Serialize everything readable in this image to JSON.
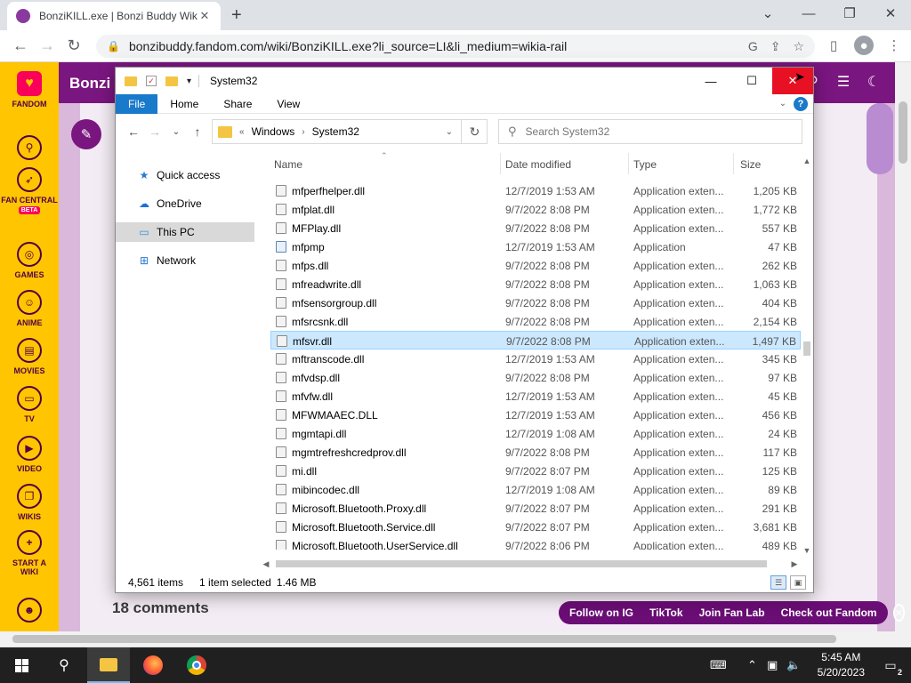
{
  "browser": {
    "tab_title": "BonziKILL.exe | Bonzi Buddy Wiki",
    "url": "bonzibuddy.fandom.com/wiki/BonziKILL.exe?li_source=LI&li_medium=wikia-rail"
  },
  "fandom_rail": {
    "logo_label": "FANDOM",
    "items": [
      {
        "label": "FAN CENTRAL",
        "badge": "BETA"
      },
      {
        "label": "GAMES"
      },
      {
        "label": "ANIME"
      },
      {
        "label": "MOVIES"
      },
      {
        "label": "TV"
      },
      {
        "label": "VIDEO"
      },
      {
        "label": "WIKIS"
      },
      {
        "label": "START A WIKI"
      }
    ]
  },
  "wiki": {
    "name": "Bonzi",
    "comments_heading": "18 comments",
    "follow_bar": [
      "Follow on IG",
      "TikTok",
      "Join Fan Lab",
      "Check out Fandom"
    ]
  },
  "explorer": {
    "window_title": "System32",
    "ribbon_tabs": [
      "File",
      "Home",
      "Share",
      "View"
    ],
    "breadcrumb": [
      "Windows",
      "System32"
    ],
    "search_placeholder": "Search System32",
    "nav_items": [
      "Quick access",
      "OneDrive",
      "This PC",
      "Network"
    ],
    "columns": {
      "name": "Name",
      "date": "Date modified",
      "type": "Type",
      "size": "Size"
    },
    "files": [
      {
        "name": "mfperfhelper.dll",
        "date": "12/7/2019 1:53 AM",
        "type": "Application exten...",
        "size": "1,205 KB"
      },
      {
        "name": "mfplat.dll",
        "date": "9/7/2022 8:08 PM",
        "type": "Application exten...",
        "size": "1,772 KB"
      },
      {
        "name": "MFPlay.dll",
        "date": "9/7/2022 8:08 PM",
        "type": "Application exten...",
        "size": "557 KB"
      },
      {
        "name": "mfpmp",
        "date": "12/7/2019 1:53 AM",
        "type": "Application",
        "size": "47 KB"
      },
      {
        "name": "mfps.dll",
        "date": "9/7/2022 8:08 PM",
        "type": "Application exten...",
        "size": "262 KB"
      },
      {
        "name": "mfreadwrite.dll",
        "date": "9/7/2022 8:08 PM",
        "type": "Application exten...",
        "size": "1,063 KB"
      },
      {
        "name": "mfsensorgroup.dll",
        "date": "9/7/2022 8:08 PM",
        "type": "Application exten...",
        "size": "404 KB"
      },
      {
        "name": "mfsrcsnk.dll",
        "date": "9/7/2022 8:08 PM",
        "type": "Application exten...",
        "size": "2,154 KB"
      },
      {
        "name": "mfsvr.dll",
        "date": "9/7/2022 8:08 PM",
        "type": "Application exten...",
        "size": "1,497 KB"
      },
      {
        "name": "mftranscode.dll",
        "date": "12/7/2019 1:53 AM",
        "type": "Application exten...",
        "size": "345 KB"
      },
      {
        "name": "mfvdsp.dll",
        "date": "9/7/2022 8:08 PM",
        "type": "Application exten...",
        "size": "97 KB"
      },
      {
        "name": "mfvfw.dll",
        "date": "12/7/2019 1:53 AM",
        "type": "Application exten...",
        "size": "45 KB"
      },
      {
        "name": "MFWMAAEC.DLL",
        "date": "12/7/2019 1:53 AM",
        "type": "Application exten...",
        "size": "456 KB"
      },
      {
        "name": "mgmtapi.dll",
        "date": "12/7/2019 1:08 AM",
        "type": "Application exten...",
        "size": "24 KB"
      },
      {
        "name": "mgmtrefreshcredprov.dll",
        "date": "9/7/2022 8:08 PM",
        "type": "Application exten...",
        "size": "117 KB"
      },
      {
        "name": "mi.dll",
        "date": "9/7/2022 8:07 PM",
        "type": "Application exten...",
        "size": "125 KB"
      },
      {
        "name": "mibincodec.dll",
        "date": "12/7/2019 1:08 AM",
        "type": "Application exten...",
        "size": "89 KB"
      },
      {
        "name": "Microsoft.Bluetooth.Proxy.dll",
        "date": "9/7/2022 8:07 PM",
        "type": "Application exten...",
        "size": "291 KB"
      },
      {
        "name": "Microsoft.Bluetooth.Service.dll",
        "date": "9/7/2022 8:07 PM",
        "type": "Application exten...",
        "size": "3,681 KB"
      },
      {
        "name": "Microsoft.Bluetooth.UserService.dll",
        "date": "9/7/2022 8:06 PM",
        "type": "Application exten...",
        "size": "489 KB"
      }
    ],
    "status": {
      "items": "4,561 items",
      "selected": "1 item selected",
      "size": "1.46 MB"
    }
  },
  "taskbar": {
    "time": "5:45 AM",
    "date": "5/20/2023",
    "notification_count": "2"
  }
}
